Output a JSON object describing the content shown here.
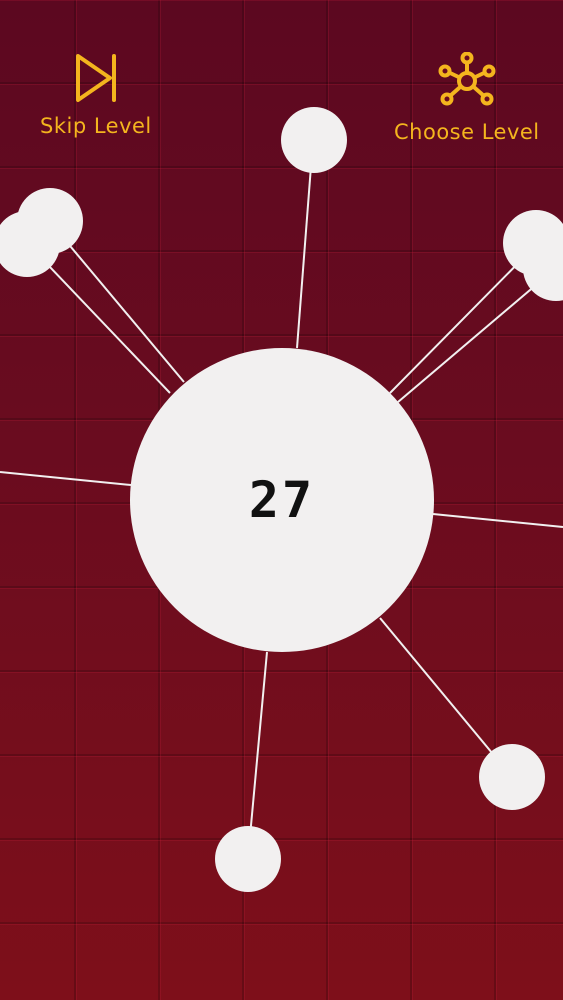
{
  "hud": {
    "skip_label": "Skip Level",
    "choose_label": "Choose Level",
    "skip_icon": "skip-forward-icon",
    "choose_icon": "network-hub-icon",
    "accent_color": "#f4b51e"
  },
  "game": {
    "score": "27",
    "background_color": "#6a0c1f",
    "ball_color": "#f2f0f0"
  }
}
